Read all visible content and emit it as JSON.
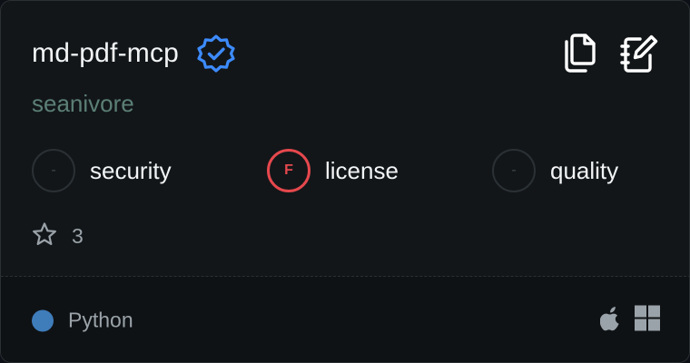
{
  "card": {
    "title": "md-pdf-mcp",
    "owner": "seanivore",
    "icons": {
      "verified": "verified-badge-icon",
      "copy": "copy-icon",
      "notebook_edit": "notebook-edit-icon",
      "star": "star-icon",
      "apple": "apple-icon",
      "windows": "windows-icon"
    },
    "scores": [
      {
        "grade": "-",
        "label": "security",
        "status": "none"
      },
      {
        "grade": "F",
        "label": "license",
        "status": "fail"
      },
      {
        "grade": "-",
        "label": "quality",
        "status": "none"
      }
    ],
    "stars": "3",
    "language": {
      "name": "Python",
      "color": "#3f7cba"
    },
    "colors": {
      "verified": "#3d8bfd",
      "fail": "#e5484d",
      "owner": "#5b7f75",
      "background": "#121619"
    }
  }
}
